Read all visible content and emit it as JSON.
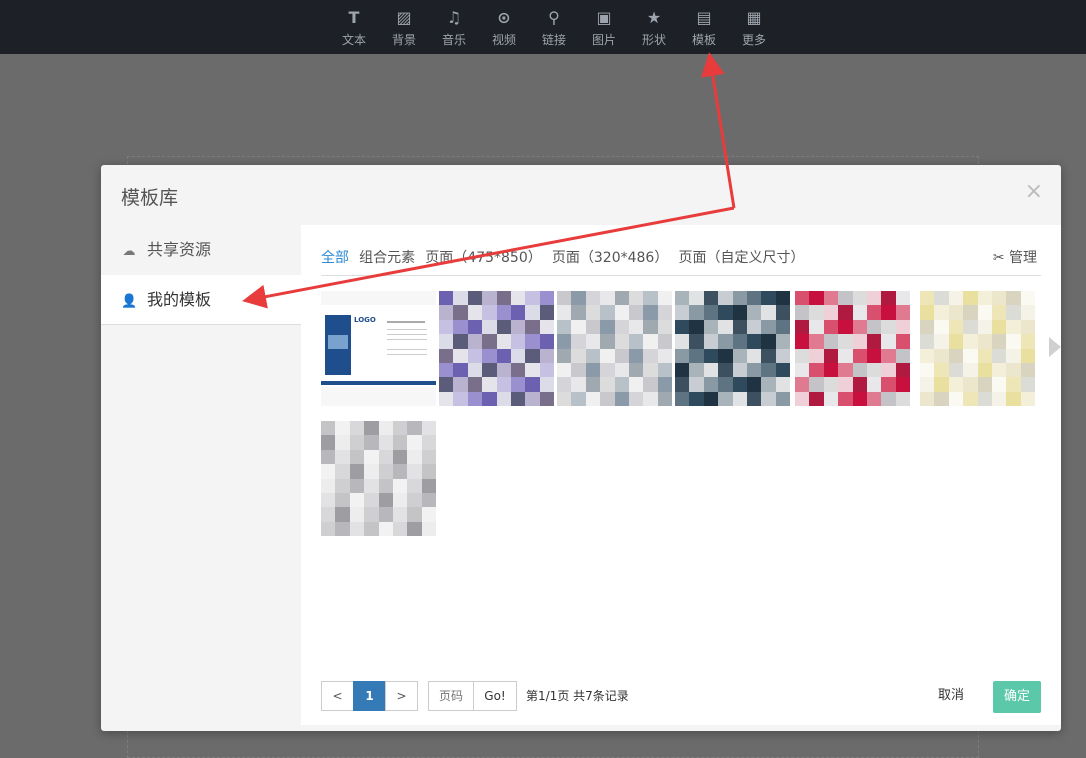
{
  "toolbar": {
    "items": [
      {
        "label": "文本",
        "icon": "text-icon",
        "glyph": "T"
      },
      {
        "label": "背景",
        "icon": "background-icon",
        "glyph": "▨"
      },
      {
        "label": "音乐",
        "icon": "music-icon",
        "glyph": "♫"
      },
      {
        "label": "视频",
        "icon": "video-icon",
        "glyph": "⊙"
      },
      {
        "label": "链接",
        "icon": "link-icon",
        "glyph": "⚲"
      },
      {
        "label": "图片",
        "icon": "image-icon",
        "glyph": "▣"
      },
      {
        "label": "形状",
        "icon": "star-icon",
        "glyph": "★"
      },
      {
        "label": "模板",
        "icon": "template-icon",
        "glyph": "▤"
      },
      {
        "label": "更多",
        "icon": "more-icon",
        "glyph": "▦"
      }
    ]
  },
  "modal": {
    "title": "模板库",
    "close": "×",
    "sidebar": [
      {
        "label": "共享资源",
        "icon": "cloud-icon",
        "glyph": "☁",
        "active": false
      },
      {
        "label": "我的模板",
        "icon": "user-icon",
        "glyph": "👤",
        "active": true
      }
    ],
    "tabs": [
      {
        "label": "全部",
        "active": true
      },
      {
        "label": "组合元素",
        "active": false
      },
      {
        "label": "页面（475*850）",
        "active": false
      },
      {
        "label": "页面（320*486）",
        "active": false
      },
      {
        "label": "页面（自定义尺寸）",
        "active": false
      }
    ],
    "manage_label": "管理",
    "manage_icon": "wrench-icon",
    "thumbnails_count": 7,
    "first_thumbnail": {
      "logo_text": "LOGO",
      "accent_color": "#1f4e8c"
    },
    "pagination": {
      "prev": "<",
      "current": "1",
      "next": ">",
      "page_placeholder": "页码",
      "go": "Go!",
      "info": "第1/1页  共7条记录"
    },
    "cancel_label": "取消",
    "ok_label": "确定"
  },
  "colors": {
    "toolbar_bg": "#1d2026",
    "accent_blue": "#2d8ad4",
    "ok_green": "#5bc9a9",
    "annotation_red": "#e83c3c"
  }
}
